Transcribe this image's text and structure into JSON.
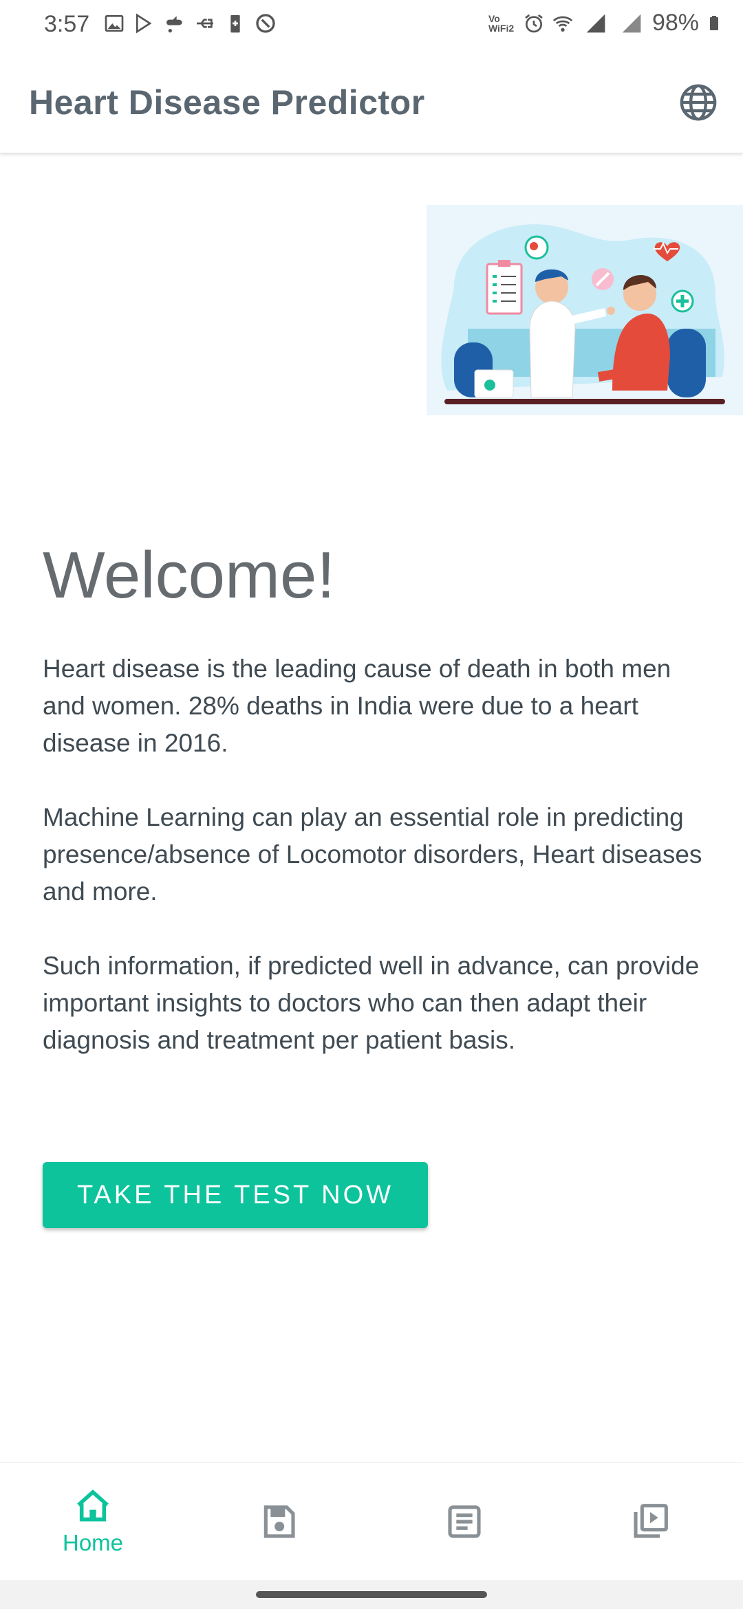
{
  "status_bar": {
    "time": "3:57",
    "battery": "98%",
    "left_icons": [
      "image-icon",
      "play-store-icon",
      "chat-icon",
      "usb-icon",
      "battery-saver-icon",
      "data-saver-icon"
    ],
    "right_icons": [
      "vowifi-icon",
      "alarm-icon",
      "wifi-icon",
      "signal-icon",
      "battery-icon"
    ],
    "vowifi_label": "Vo WiFi2"
  },
  "app_bar": {
    "title": "Heart Disease Predictor",
    "action_icon": "globe-icon"
  },
  "main": {
    "illustration": "doctor-patient-illustration",
    "heading": "Welcome!",
    "paragraphs": [
      "Heart disease is the leading cause of death in both men and women. 28% deaths in India were due to a heart disease in 2016.",
      "Machine Learning can play an essential role in predicting presence/absence of Locomotor disorders, Heart diseases and more.",
      "Such information, if predicted well in advance, can provide important insights to doctors who can then adapt their diagnosis and treatment per patient basis."
    ],
    "cta_label": "TAKE THE TEST NOW"
  },
  "bottom_nav": {
    "items": [
      {
        "label": "Home",
        "icon": "home-icon",
        "active": true
      },
      {
        "label": "",
        "icon": "save-icon",
        "active": false
      },
      {
        "label": "",
        "icon": "article-icon",
        "active": false
      },
      {
        "label": "",
        "icon": "video-library-icon",
        "active": false
      }
    ]
  },
  "colors": {
    "accent": "#0cc39c",
    "title": "#5a6670",
    "text": "#3f4a52",
    "inactive_icon": "#8a9196"
  }
}
